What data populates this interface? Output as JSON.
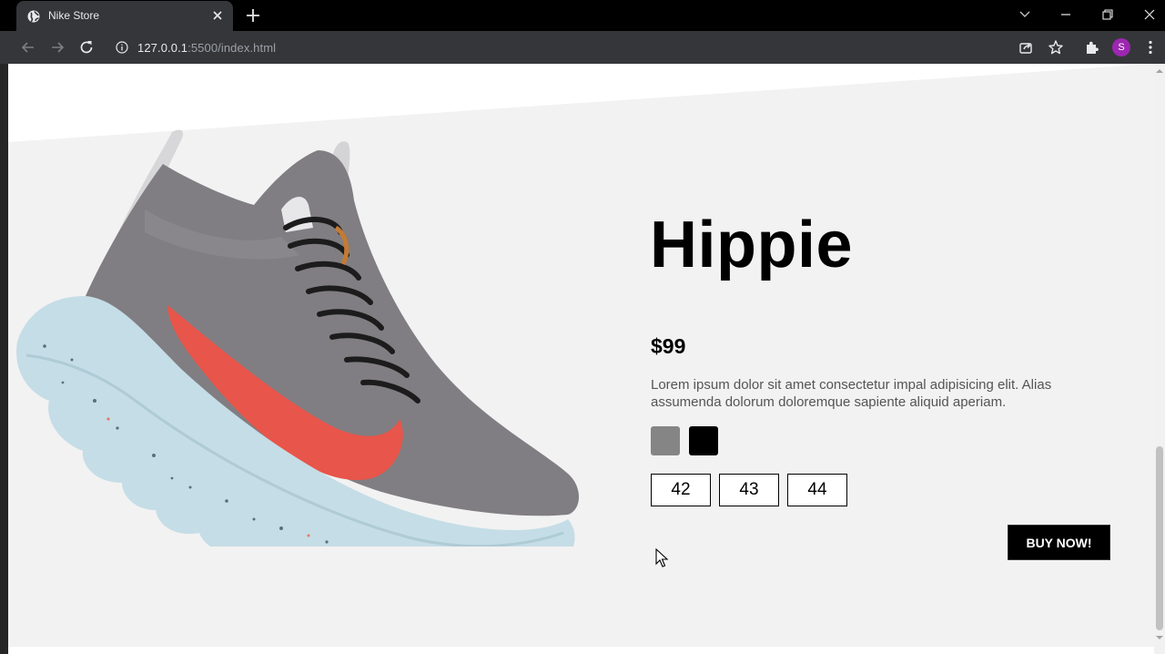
{
  "browser": {
    "tab_title": "Nike Store",
    "url_host": "127.0.0.1",
    "url_path": ":5500/index.html",
    "profile_initial": "S",
    "icons": [
      "globe-icon",
      "close-icon",
      "plus-icon",
      "chevron-down-icon",
      "minimize-icon",
      "restore-icon",
      "back-icon",
      "forward-icon",
      "reload-icon",
      "info-icon",
      "share-icon",
      "star-icon",
      "puzzle-icon",
      "kebab-menu-icon"
    ]
  },
  "product": {
    "title": "Hippie",
    "price": "$99",
    "description": "Lorem ipsum dolor sit amet consectetur impal adipisicing elit. Alias assumenda dolorum doloremque sapiente aliquid aperiam.",
    "colors": [
      {
        "name": "gray",
        "hex": "#858585"
      },
      {
        "name": "black",
        "hex": "#000000"
      }
    ],
    "sizes": [
      "42",
      "43",
      "44"
    ],
    "buy_label": "BUY NOW!"
  },
  "theme": {
    "page_bg": "#f2f2f2",
    "accent": "#000000",
    "sole": "#c5dde6",
    "swoosh": "#e8554a"
  }
}
